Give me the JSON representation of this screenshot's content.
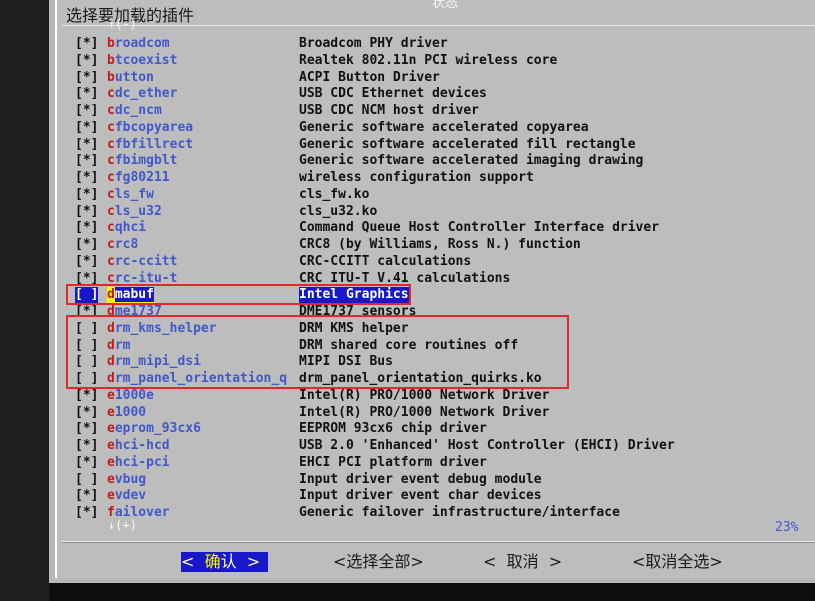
{
  "dialog": {
    "top_mark": "状态",
    "title": "选择要加载的插件",
    "scroll_up": "↑(-)",
    "scroll_down": "↓(+)",
    "scroll_percent": "23%"
  },
  "items": [
    {
      "check": "[*]",
      "first": "b",
      "rest": "roadcom",
      "desc": "Broadcom PHY driver"
    },
    {
      "check": "[*]",
      "first": "b",
      "rest": "tcoexist",
      "desc": "Realtek 802.11n PCI wireless core"
    },
    {
      "check": "[*]",
      "first": "b",
      "rest": "utton",
      "desc": "ACPI Button Driver"
    },
    {
      "check": "[*]",
      "first": "c",
      "rest": "dc_ether",
      "desc": "USB CDC Ethernet devices"
    },
    {
      "check": "[*]",
      "first": "c",
      "rest": "dc_ncm",
      "desc": "USB CDC NCM host driver"
    },
    {
      "check": "[*]",
      "first": "c",
      "rest": "fbcopyarea",
      "desc": "Generic software accelerated copyarea"
    },
    {
      "check": "[*]",
      "first": "c",
      "rest": "fbfillrect",
      "desc": "Generic software accelerated fill rectangle"
    },
    {
      "check": "[*]",
      "first": "c",
      "rest": "fbimgblt",
      "desc": "Generic software accelerated imaging drawing"
    },
    {
      "check": "[*]",
      "first": "c",
      "rest": "fg80211",
      "desc": "wireless configuration support"
    },
    {
      "check": "[*]",
      "first": "c",
      "rest": "ls_fw",
      "desc": "cls_fw.ko"
    },
    {
      "check": "[*]",
      "first": "c",
      "rest": "ls_u32",
      "desc": "cls_u32.ko"
    },
    {
      "check": "[*]",
      "first": "c",
      "rest": "qhci",
      "desc": "Command Queue Host Controller Interface driver"
    },
    {
      "check": "[*]",
      "first": "c",
      "rest": "rc8",
      "desc": "CRC8 (by Williams, Ross N.) function"
    },
    {
      "check": "[*]",
      "first": "c",
      "rest": "rc-ccitt",
      "desc": "CRC-CCITT calculations"
    },
    {
      "check": "[*]",
      "first": "c",
      "rest": "rc-itu-t",
      "desc": "CRC ITU-T V.41 calculations"
    },
    {
      "check": "[ ]",
      "first": "d",
      "rest": "mabuf",
      "desc": "Intel Graphics",
      "selected": true
    },
    {
      "check": "[*]",
      "first": "d",
      "rest": "me1737",
      "desc": "DME1737 sensors"
    },
    {
      "check": "[ ]",
      "first": "d",
      "rest": "rm_kms_helper",
      "desc": "DRM KMS helper"
    },
    {
      "check": "[ ]",
      "first": "d",
      "rest": "rm",
      "desc": "DRM shared core routines off"
    },
    {
      "check": "[ ]",
      "first": "d",
      "rest": "rm_mipi_dsi",
      "desc": "MIPI DSI Bus"
    },
    {
      "check": "[ ]",
      "first": "d",
      "rest": "rm_panel_orientation_q",
      "desc": "drm_panel_orientation_quirks.ko"
    },
    {
      "check": "[*]",
      "first": "e",
      "rest": "1000e",
      "desc": "Intel(R) PRO/1000 Network Driver"
    },
    {
      "check": "[*]",
      "first": "e",
      "rest": "1000",
      "desc": "Intel(R) PRO/1000 Network Driver"
    },
    {
      "check": "[*]",
      "first": "e",
      "rest": "eprom_93cx6",
      "desc": "EEPROM 93cx6 chip driver"
    },
    {
      "check": "[*]",
      "first": "e",
      "rest": "hci-hcd",
      "desc": "USB 2.0 'Enhanced' Host Controller (EHCI) Driver"
    },
    {
      "check": "[*]",
      "first": "e",
      "rest": "hci-pci",
      "desc": "EHCI PCI platform driver"
    },
    {
      "check": "[ ]",
      "first": "e",
      "rest": "vbug",
      "desc": "Input driver event debug module"
    },
    {
      "check": "[*]",
      "first": "e",
      "rest": "vdev",
      "desc": "Input driver event char devices"
    },
    {
      "check": "[*]",
      "first": "f",
      "rest": "ailover",
      "desc": "Generic failover infrastructure/interface"
    }
  ],
  "buttons": {
    "ok_left": "<  ",
    "ok_hot": "确",
    "ok_rest": "认  >",
    "select_all": "<选择全部>",
    "cancel": "<  取消  >",
    "deselect_all": "<取消全选>"
  },
  "colors": {
    "selection_bg": "#1818c8",
    "hotkey": "#c41a1a",
    "annotation_box": "#e02a2a"
  }
}
